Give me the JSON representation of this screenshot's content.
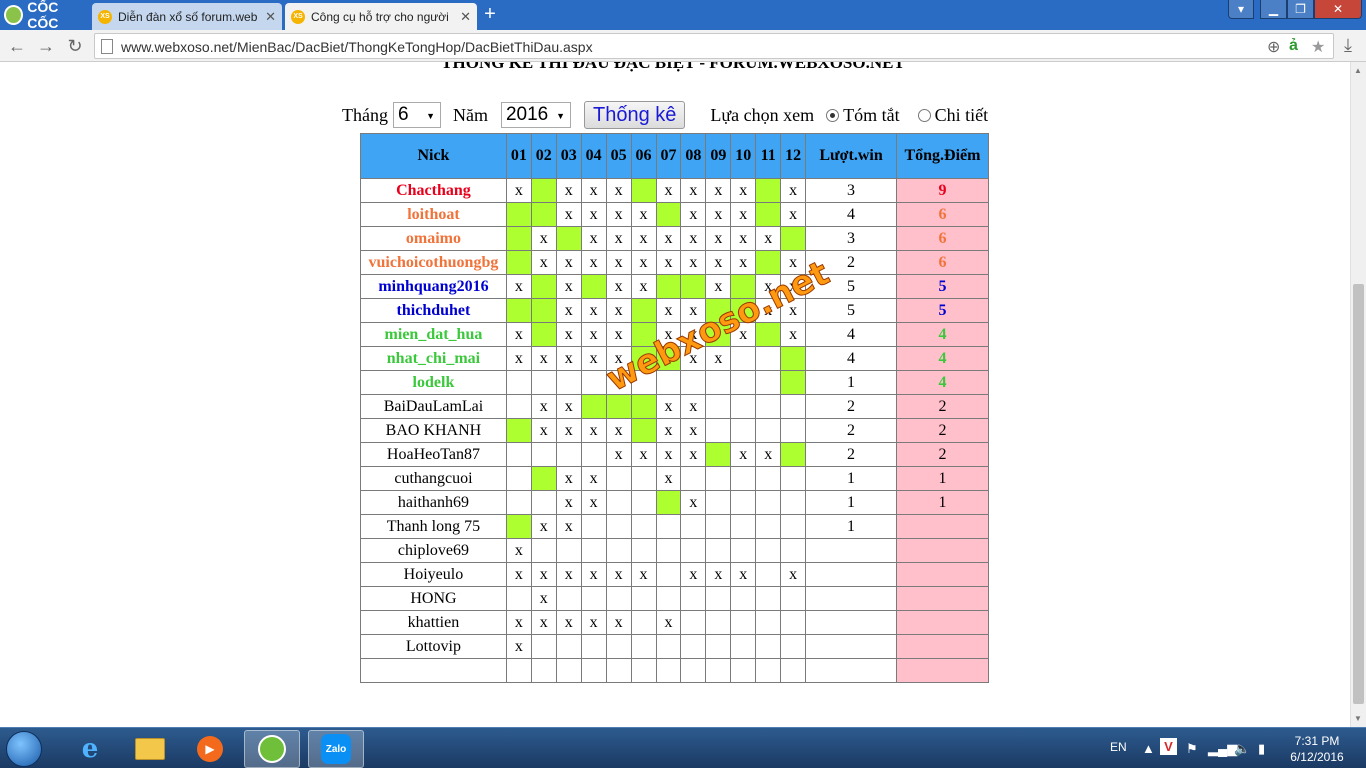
{
  "browser": {
    "brand": "CỐC CỐC",
    "tabs": [
      {
        "favicon": "XS",
        "title": "Diễn đàn xổ số forum.web"
      },
      {
        "favicon": "XS",
        "title": "Công cụ hỗ trợ cho người"
      }
    ],
    "new_tab": "+",
    "url": "www.webxoso.net/MienBac/DacBiet/ThongKeTongHop/DacBietThiDau.aspx"
  },
  "page": {
    "title": "THỐNG KÊ THI ĐẤU ĐẶC BIỆT - FORUM.WEBXOSO.NET",
    "month_label": "Tháng",
    "month_value": "6",
    "year_label": "Năm",
    "year_value": "2016",
    "stats_button": "Thống kê",
    "view_label": "Lựa chọn xem",
    "view_options": [
      {
        "label": "Tóm tắt",
        "selected": true
      },
      {
        "label": "Chi tiết",
        "selected": false
      }
    ],
    "watermark": "webxoso.net"
  },
  "table": {
    "headers": [
      "Nick",
      "01",
      "02",
      "03",
      "04",
      "05",
      "06",
      "07",
      "08",
      "09",
      "10",
      "11",
      "12",
      "Lượt.win",
      "Tổng.Điểm"
    ],
    "colors": {
      "red": "#e8001c",
      "orange": "#f0733a",
      "blue": "#0000d0",
      "green": "#3cc83c",
      "cell_green": "#adff2f",
      "cell_pink": "#ffc0cb",
      "header_blue": "#3fa4f3"
    },
    "rows": [
      {
        "nick": "Chacthang",
        "color": "red",
        "cells": "xgxxxgxxxxgx",
        "wins": "3",
        "points": "9"
      },
      {
        "nick": "loithoat",
        "color": "orange",
        "cells": "ggxxxxgxxxgx",
        "wins": "4",
        "points": "6"
      },
      {
        "nick": "omaimo",
        "color": "orange",
        "cells": "gxgxxxxxxxxg",
        "wins": "3",
        "points": "6"
      },
      {
        "nick": "vuichoicothuongbg",
        "color": "orange",
        "cells": "gxxxxxxxxxgx",
        "wins": "2",
        "points": "6"
      },
      {
        "nick": "minhquang2016",
        "color": "blue",
        "cells": "xgxgxxggxgxx",
        "wins": "5",
        "points": "5"
      },
      {
        "nick": "thichduhet",
        "color": "blue",
        "cells": "ggxxxgxxggxx",
        "wins": "5",
        "points": "5"
      },
      {
        "nick": "mien_dat_hua",
        "color": "green",
        "cells": "xgxxxgxxgxgx",
        "wins": "4",
        "points": "4"
      },
      {
        "nick": "nhat_chi_mai",
        "color": "green",
        "cells": "xxxxxggxx..g",
        "wins": "4",
        "points": "4"
      },
      {
        "nick": "lodelk",
        "color": "green",
        "cells": "...........g",
        "wins": "1",
        "points": "4"
      },
      {
        "nick": "BaiDauLamLai",
        "color": "black",
        "cells": ".xxgggxx....",
        "wins": "2",
        "points": "2"
      },
      {
        "nick": "BAO KHANH",
        "color": "black",
        "cells": "gxxxxgxx....",
        "wins": "2",
        "points": "2"
      },
      {
        "nick": "HoaHeoTan87",
        "color": "black",
        "cells": "....xxxxgxxg",
        "wins": "2",
        "points": "2"
      },
      {
        "nick": "cuthangcuoi",
        "color": "black",
        "cells": ".gxx..x.....",
        "wins": "1",
        "points": "1"
      },
      {
        "nick": "haithanh69",
        "color": "black",
        "cells": "..xx..gx....",
        "wins": "1",
        "points": "1"
      },
      {
        "nick": "Thanh long 75",
        "color": "black",
        "cells": "gxx.........",
        "wins": "1",
        "points": ""
      },
      {
        "nick": "chiplove69",
        "color": "black",
        "cells": "x...........",
        "wins": "",
        "points": ""
      },
      {
        "nick": "Hoiyeulo",
        "color": "black",
        "cells": "xxxxxx.xxx.x",
        "wins": "",
        "points": ""
      },
      {
        "nick": "HONG",
        "color": "black",
        "cells": ".x..........",
        "wins": "",
        "points": ""
      },
      {
        "nick": "khattien",
        "color": "black",
        "cells": "xxxxx.x.....",
        "wins": "",
        "points": ""
      },
      {
        "nick": "Lottovip",
        "color": "black",
        "cells": "x...........",
        "wins": "",
        "points": ""
      },
      {
        "nick": "",
        "color": "black",
        "cells": "............",
        "wins": "",
        "points": ""
      }
    ]
  },
  "taskbar": {
    "apps": [
      "start-orb",
      "ie-icon",
      "explorer-icon",
      "media-player-icon",
      "coccoc-icon",
      "zalo-icon"
    ],
    "zalo_label": "Zalo",
    "lang": "EN",
    "time": "7:31 PM",
    "date": "6/12/2016"
  }
}
